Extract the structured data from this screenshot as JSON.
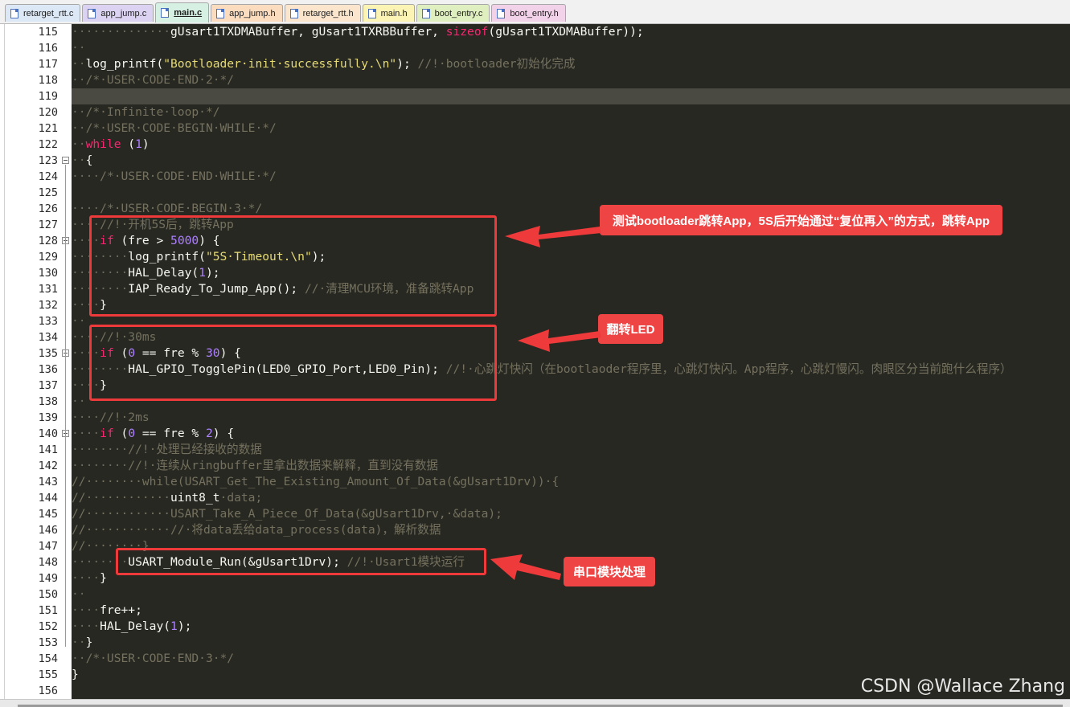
{
  "tabs": [
    {
      "label": "retarget_rtt.c",
      "color": "#dde8f7",
      "active": false
    },
    {
      "label": "app_jump.c",
      "color": "#dcd3f2",
      "active": false
    },
    {
      "label": "main.c",
      "color": "#d6f0e3",
      "active": true
    },
    {
      "label": "app_jump.h",
      "color": "#fcdcbf",
      "active": false
    },
    {
      "label": "retarget_rtt.h",
      "color": "#fbe6cd",
      "active": false
    },
    {
      "label": "main.h",
      "color": "#fbf4b4",
      "active": false
    },
    {
      "label": "boot_entry.c",
      "color": "#e0efc0",
      "active": false
    },
    {
      "label": "boot_entry.h",
      "color": "#f2d2e8",
      "active": false
    }
  ],
  "editor": {
    "current_line": 119,
    "lines": [
      {
        "n": 115,
        "segs": [
          [
            "ws",
            "··············"
          ],
          [
            "t",
            "gUsart1TXDMABuffer, gUsart1TXRBBuffer, "
          ],
          [
            "kw",
            "sizeof"
          ],
          [
            "t",
            "(gUsart1TXDMABuffer));"
          ]
        ]
      },
      {
        "n": 116,
        "segs": [
          [
            "ws",
            "··"
          ]
        ]
      },
      {
        "n": 117,
        "segs": [
          [
            "ws",
            "··"
          ],
          [
            "t",
            "log_printf("
          ],
          [
            "str",
            "\"Bootloader·init·successfully.\\n\""
          ],
          [
            "t",
            "); "
          ],
          [
            "cm",
            "//!·bootloader初始化完成"
          ]
        ]
      },
      {
        "n": 118,
        "segs": [
          [
            "ws",
            "··"
          ],
          [
            "cm",
            "/*·USER·CODE·END·2·*/"
          ]
        ]
      },
      {
        "n": 119,
        "segs": [
          [
            "ws",
            ""
          ]
        ]
      },
      {
        "n": 120,
        "segs": [
          [
            "ws",
            "··"
          ],
          [
            "cm",
            "/*·Infinite·loop·*/"
          ]
        ]
      },
      {
        "n": 121,
        "segs": [
          [
            "ws",
            "··"
          ],
          [
            "cm",
            "/*·USER·CODE·BEGIN·WHILE·*/"
          ]
        ]
      },
      {
        "n": 122,
        "segs": [
          [
            "ws",
            "··"
          ],
          [
            "kw",
            "while"
          ],
          [
            "t",
            " ("
          ],
          [
            "num",
            "1"
          ],
          [
            "t",
            ")"
          ]
        ]
      },
      {
        "n": 123,
        "segs": [
          [
            "ws",
            "··"
          ],
          [
            "t",
            "{"
          ]
        ]
      },
      {
        "n": 124,
        "segs": [
          [
            "ws",
            "····"
          ],
          [
            "cm",
            "/*·USER·CODE·END·WHILE·*/"
          ]
        ]
      },
      {
        "n": 125,
        "segs": [
          [
            "ws",
            ""
          ]
        ]
      },
      {
        "n": 126,
        "segs": [
          [
            "ws",
            "····"
          ],
          [
            "cm",
            "/*·USER·CODE·BEGIN·3·*/"
          ]
        ]
      },
      {
        "n": 127,
        "segs": [
          [
            "ws",
            "····"
          ],
          [
            "cm",
            "//!·开机5S后，跳转App"
          ]
        ]
      },
      {
        "n": 128,
        "segs": [
          [
            "ws",
            "····"
          ],
          [
            "kw",
            "if"
          ],
          [
            "t",
            " (fre > "
          ],
          [
            "num",
            "5000"
          ],
          [
            "t",
            ") {"
          ]
        ]
      },
      {
        "n": 129,
        "segs": [
          [
            "ws",
            "········"
          ],
          [
            "t",
            "log_printf("
          ],
          [
            "str",
            "\"5S·Timeout.\\n\""
          ],
          [
            "t",
            ");"
          ]
        ]
      },
      {
        "n": 130,
        "segs": [
          [
            "ws",
            "········"
          ],
          [
            "t",
            "HAL_Delay("
          ],
          [
            "num",
            "1"
          ],
          [
            "t",
            ");"
          ]
        ]
      },
      {
        "n": 131,
        "segs": [
          [
            "ws",
            "········"
          ],
          [
            "t",
            "IAP_Ready_To_Jump_App(); "
          ],
          [
            "cm",
            "//·清理MCU环境，准备跳转App"
          ]
        ]
      },
      {
        "n": 132,
        "segs": [
          [
            "ws",
            "····"
          ],
          [
            "t",
            "}"
          ]
        ]
      },
      {
        "n": 133,
        "segs": [
          [
            "ws",
            "··"
          ]
        ]
      },
      {
        "n": 134,
        "segs": [
          [
            "ws",
            "····"
          ],
          [
            "cm",
            "//!·30ms"
          ]
        ]
      },
      {
        "n": 135,
        "segs": [
          [
            "ws",
            "····"
          ],
          [
            "kw",
            "if"
          ],
          [
            "t",
            " ("
          ],
          [
            "num",
            "0"
          ],
          [
            "t",
            " == fre % "
          ],
          [
            "num",
            "30"
          ],
          [
            "t",
            ") {"
          ]
        ]
      },
      {
        "n": 136,
        "segs": [
          [
            "ws",
            "········"
          ],
          [
            "t",
            "HAL_GPIO_TogglePin(LED0_GPIO_Port,LED0_Pin); "
          ],
          [
            "cm",
            "//!·心跳灯快闪（在bootlaoder程序里，心跳灯快闪。App程序，心跳灯慢闪。肉眼区分当前跑什么程序）"
          ]
        ]
      },
      {
        "n": 137,
        "segs": [
          [
            "ws",
            "····"
          ],
          [
            "t",
            "}"
          ]
        ]
      },
      {
        "n": 138,
        "segs": [
          [
            "ws",
            "··"
          ]
        ]
      },
      {
        "n": 139,
        "segs": [
          [
            "ws",
            "····"
          ],
          [
            "cm",
            "//!·2ms"
          ]
        ]
      },
      {
        "n": 140,
        "segs": [
          [
            "ws",
            "····"
          ],
          [
            "kw",
            "if"
          ],
          [
            "t",
            " ("
          ],
          [
            "num",
            "0"
          ],
          [
            "t",
            " == fre % "
          ],
          [
            "num",
            "2"
          ],
          [
            "t",
            ") {"
          ]
        ]
      },
      {
        "n": 141,
        "segs": [
          [
            "ws",
            "········"
          ],
          [
            "cm",
            "//!·处理已经接收的数据"
          ]
        ]
      },
      {
        "n": 142,
        "segs": [
          [
            "ws",
            "········"
          ],
          [
            "cm",
            "//!·连续从ringbuffer里拿出数据来解释，直到没有数据"
          ]
        ]
      },
      {
        "n": 143,
        "segs": [
          [
            "cm",
            "//········while(USART_Get_The_Existing_Amount_Of_Data(&gUsart1Drv))·{"
          ]
        ]
      },
      {
        "n": 144,
        "segs": [
          [
            "cm",
            "//············"
          ],
          [
            "t",
            "uint8_t"
          ],
          [
            "cm",
            "·data;"
          ]
        ]
      },
      {
        "n": 145,
        "segs": [
          [
            "cm",
            "//············USART_Take_A_Piece_Of_Data(&gUsart1Drv,·&data);"
          ]
        ]
      },
      {
        "n": 146,
        "segs": [
          [
            "cm",
            "//············//·将data丢给data_process(data)，解析数据"
          ]
        ]
      },
      {
        "n": 147,
        "segs": [
          [
            "cm",
            "//········}"
          ]
        ]
      },
      {
        "n": 148,
        "segs": [
          [
            "ws",
            "········"
          ],
          [
            "t",
            "USART_Module_Run(&gUsart1Drv); "
          ],
          [
            "cm",
            "//!·Usart1模块运行"
          ]
        ]
      },
      {
        "n": 149,
        "segs": [
          [
            "ws",
            "····"
          ],
          [
            "t",
            "}"
          ]
        ]
      },
      {
        "n": 150,
        "segs": [
          [
            "ws",
            "··"
          ]
        ]
      },
      {
        "n": 151,
        "segs": [
          [
            "ws",
            "····"
          ],
          [
            "t",
            "fre++;"
          ]
        ]
      },
      {
        "n": 152,
        "segs": [
          [
            "ws",
            "····"
          ],
          [
            "t",
            "HAL_Delay("
          ],
          [
            "num",
            "1"
          ],
          [
            "t",
            ");"
          ]
        ]
      },
      {
        "n": 153,
        "segs": [
          [
            "ws",
            "··"
          ],
          [
            "t",
            "}"
          ]
        ]
      },
      {
        "n": 154,
        "segs": [
          [
            "ws",
            "··"
          ],
          [
            "cm",
            "/*·USER·CODE·END·3·*/"
          ]
        ]
      },
      {
        "n": 155,
        "segs": [
          [
            "t",
            "}"
          ]
        ]
      },
      {
        "n": 156,
        "segs": [
          [
            "ws",
            ""
          ]
        ]
      }
    ],
    "fold_lines": [
      123,
      128,
      135,
      140
    ]
  },
  "annotations": {
    "callout_jump": "测试bootloader跳转App，5S后开始通过“复位再入”的方式，跳转App",
    "callout_led": "翻转LED",
    "callout_uart": "串口模块处理",
    "accent_color": "#ef4444"
  },
  "watermark": "CSDN @Wallace Zhang"
}
